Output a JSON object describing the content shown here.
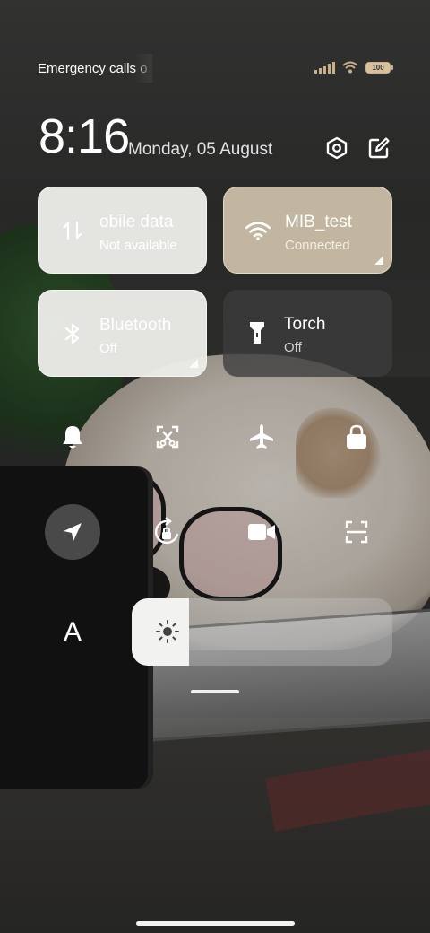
{
  "status_bar": {
    "carrier_text": "Emergency calls o",
    "battery_level": "100",
    "signal_icon": "cellular-signal-icon",
    "wifi_icon": "wifi-icon"
  },
  "header": {
    "time": "8:16",
    "date": "Monday, 05 August",
    "settings_icon": "settings-hexagon-icon",
    "edit_icon": "edit-icon"
  },
  "tiles": [
    {
      "title": "obile data",
      "subtitle": "Not available",
      "icon": "mobile-data-icon",
      "state": "unavailable"
    },
    {
      "title": "MIB_test",
      "subtitle": "Connected",
      "icon": "wifi-icon",
      "state": "on"
    },
    {
      "title": "Bluetooth",
      "subtitle": "Off",
      "icon": "bluetooth-icon",
      "state": "off"
    },
    {
      "title": "Torch",
      "subtitle": "Off",
      "icon": "torch-icon",
      "state": "off"
    }
  ],
  "toggles": [
    {
      "icon": "bell-icon"
    },
    {
      "icon": "screenshot-icon"
    },
    {
      "icon": "airplane-icon"
    },
    {
      "icon": "lock-icon"
    },
    {
      "icon": "location-icon",
      "active": true
    },
    {
      "icon": "rotation-lock-icon"
    },
    {
      "icon": "video-camera-icon"
    },
    {
      "icon": "scanner-icon"
    }
  ],
  "auto_brightness_label": "A",
  "brightness_level": 0.22,
  "colors": {
    "wifi_tile": "#c7bba4",
    "light_tile": "#ececE8",
    "dark_tile": "#3c3c3c",
    "accent_battery": "#c9b08a"
  }
}
